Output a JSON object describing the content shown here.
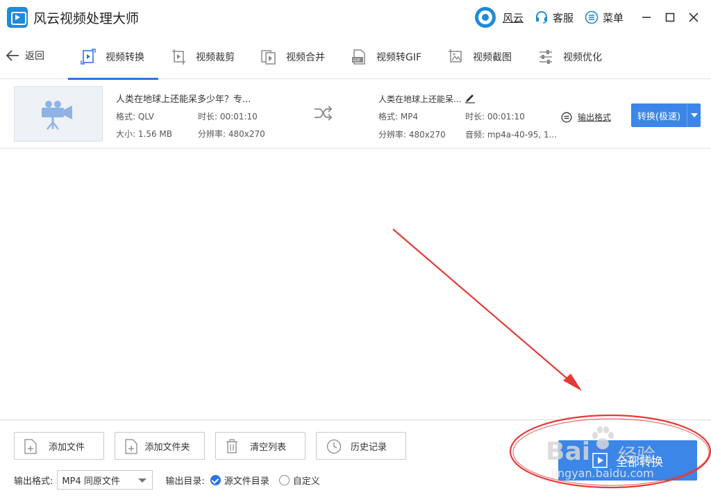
{
  "app": {
    "title": "风云视频处理大师"
  },
  "titlebar": {
    "user_label": "风云",
    "service_label": "客服",
    "menu_label": "菜单"
  },
  "toolbar": {
    "back_label": "返回",
    "tabs": [
      {
        "label": "视频转换",
        "icon": "video-convert-icon",
        "active": true
      },
      {
        "label": "视频裁剪",
        "icon": "video-crop-icon"
      },
      {
        "label": "视频合并",
        "icon": "video-merge-icon"
      },
      {
        "label": "视频转GIF",
        "icon": "gif-icon"
      },
      {
        "label": "视频截图",
        "icon": "screenshot-icon"
      },
      {
        "label": "视频优化",
        "icon": "optimize-icon"
      }
    ]
  },
  "file": {
    "source": {
      "name": "人类在地球上还能呆多少年？专...",
      "format": "格式: QLV",
      "duration": "时长: 00:01:10",
      "size": "大小: 1.56 MB",
      "resolution": "分辨率: 480x270"
    },
    "output": {
      "name": "人类在地球上还能呆...",
      "format": "格式: MP4",
      "duration": "时长: 00:01:10",
      "resolution": "分辨率: 480x270",
      "audio": "音频: mp4a-40-95, 1..."
    },
    "output_format_link": "输出格式",
    "convert_button": "转换(极速)"
  },
  "bottom": {
    "add_file": "添加文件",
    "add_folder": "添加文件夹",
    "clear_list": "清空列表",
    "history": "历史记录",
    "output_format_label": "输出格式:",
    "output_format_value": "MP4 同原文件",
    "output_dir_label": "输出目录:",
    "dir_option_source": "源文件目录",
    "dir_option_custom": "自定义",
    "convert_all": "全部转换"
  },
  "watermark": {
    "logo": "Bai",
    "cn": "经验",
    "url": "jingyan.baidu.com"
  },
  "colors": {
    "accent": "#3b86e7",
    "annotation": "#e53935"
  }
}
